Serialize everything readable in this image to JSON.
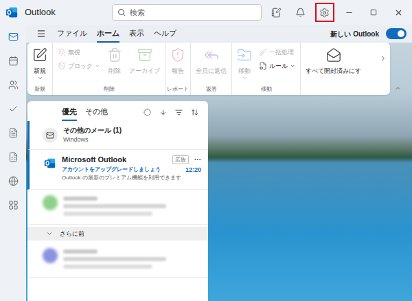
{
  "window": {
    "title": "Outlook"
  },
  "search": {
    "placeholder": "検索"
  },
  "title_actions": [
    {
      "highlighted": false
    },
    {
      "highlighted": false
    },
    {
      "highlighted": true
    }
  ],
  "nav_rail": [
    {
      "selected": true
    },
    {
      "selected": false
    },
    {
      "selected": false
    },
    {
      "selected": false
    },
    {
      "selected": false
    },
    {
      "selected": false
    },
    {
      "selected": false
    },
    {
      "selected": false
    }
  ],
  "menu": {
    "tabs": [
      {
        "label": "ファイル",
        "selected": false
      },
      {
        "label": "ホーム",
        "selected": true
      },
      {
        "label": "表示",
        "selected": false
      },
      {
        "label": "ヘルプ",
        "selected": false
      }
    ],
    "toggle": {
      "label": "新しい Outlook",
      "on": true
    }
  },
  "ribbon": {
    "groups": [
      {
        "label": "新規",
        "items": [
          {
            "kind": "large",
            "label": "新規",
            "disabled": false,
            "dropdown": true
          }
        ]
      },
      {
        "label": "削除",
        "items": [
          {
            "kind": "stack",
            "entries": [
              {
                "label": "無視",
                "disabled": true,
                "dropdown": false
              },
              {
                "label": "ブロック",
                "disabled": true,
                "dropdown": true
              }
            ]
          },
          {
            "kind": "large",
            "label": "削除",
            "disabled": true,
            "dropdown": false
          },
          {
            "kind": "large",
            "label": "アーカイブ",
            "disabled": true,
            "dropdown": false
          }
        ]
      },
      {
        "label": "レポート",
        "items": [
          {
            "kind": "large",
            "label": "報告",
            "disabled": true,
            "dropdown": false
          }
        ]
      },
      {
        "label": "返答",
        "items": [
          {
            "kind": "large",
            "label": "全員に返信",
            "disabled": true,
            "dropdown": false
          }
        ]
      },
      {
        "label": "移動",
        "items": [
          {
            "kind": "large",
            "label": "移動",
            "disabled": true,
            "dropdown": true
          },
          {
            "kind": "stack",
            "entries": [
              {
                "label": "一括処理",
                "disabled": true,
                "dropdown": false
              },
              {
                "label": "ルール",
                "disabled": false,
                "dropdown": true
              }
            ]
          }
        ]
      },
      {
        "items": [
          {
            "kind": "large",
            "label": "すべて開封済みにす",
            "disabled": false,
            "dropdown": false
          }
        ]
      }
    ]
  },
  "mail_list": {
    "tabs": [
      {
        "label": "優先",
        "selected": true
      },
      {
        "label": "その他",
        "selected": false
      }
    ],
    "items": [
      {
        "kind": "group",
        "title": "その他のメール (1)",
        "subtitle": "Windows",
        "unread": true
      },
      {
        "kind": "ad",
        "sender": "Microsoft Outlook",
        "badge": "広告",
        "more": "···",
        "subject": "アカウントをアップグレードしましょう",
        "time": "12:20",
        "preview": "Outlook の最新のプレミアム機能を利用できます",
        "unread": true
      },
      {
        "kind": "blurred",
        "avatar_color": "#8fd08a",
        "unread": false
      },
      {
        "kind": "section",
        "label": "さらに前",
        "expanded": true
      },
      {
        "kind": "blurred",
        "avatar_color": "#8a93e0",
        "unread": false
      }
    ]
  }
}
